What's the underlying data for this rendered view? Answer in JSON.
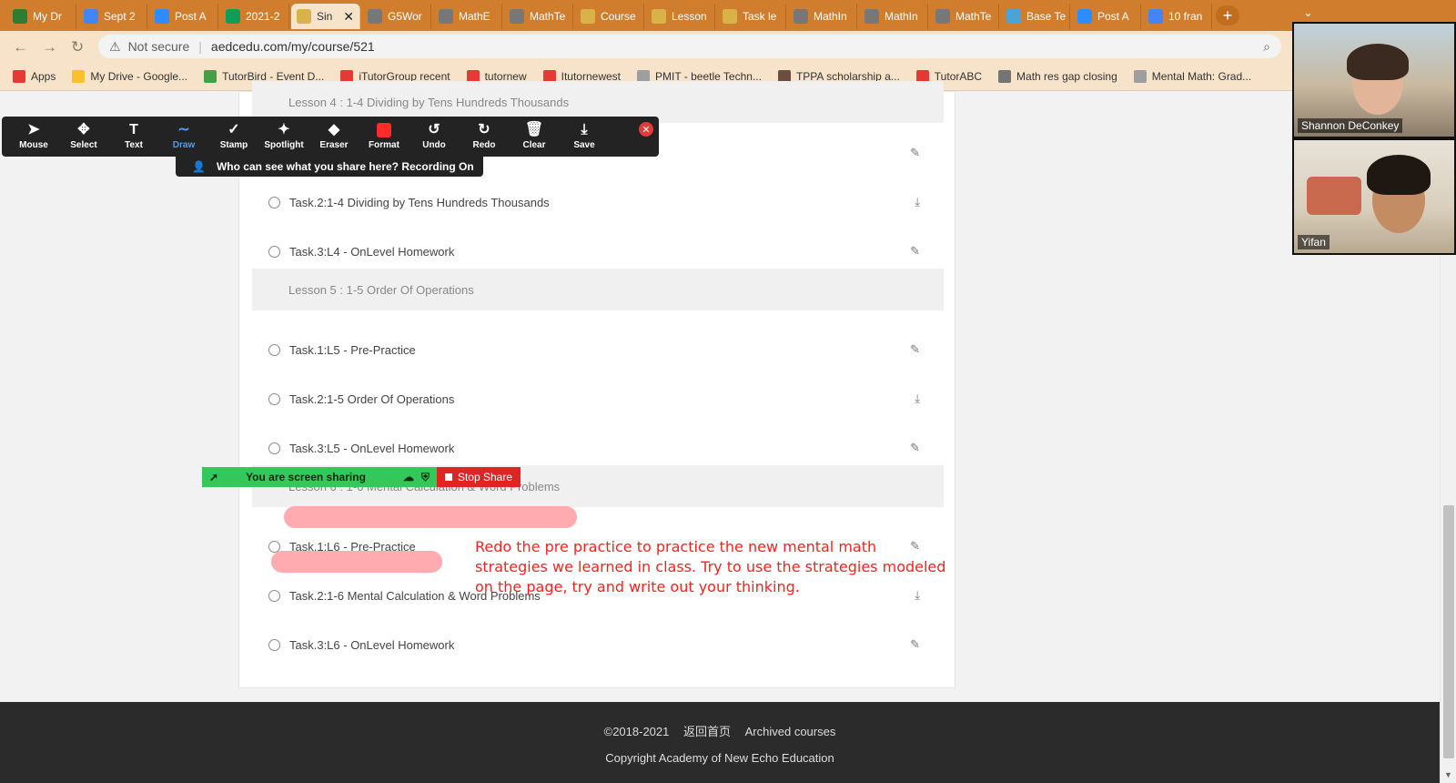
{
  "browser": {
    "tabs": [
      {
        "label": "My Dr",
        "icon": "google-drive-icon",
        "color": "#2f7d32"
      },
      {
        "label": "Sept 2",
        "icon": "google-docs-icon",
        "color": "#4285f4"
      },
      {
        "label": "Post A",
        "icon": "zoom-icon",
        "color": "#2d8cff"
      },
      {
        "label": "2021-2",
        "icon": "google-sheets-icon",
        "color": "#0f9d58"
      },
      {
        "label": "Sin",
        "icon": "site-icon",
        "color": "#d9b34a",
        "active": true
      },
      {
        "label": "G5Wor",
        "icon": "globe-icon",
        "color": "#777777"
      },
      {
        "label": "MathE",
        "icon": "globe-icon",
        "color": "#777777"
      },
      {
        "label": "MathTe",
        "icon": "globe-icon",
        "color": "#777777"
      },
      {
        "label": "Course",
        "icon": "site-icon",
        "color": "#d9b34a"
      },
      {
        "label": "Lesson",
        "icon": "site-icon",
        "color": "#d9b34a"
      },
      {
        "label": "Task le",
        "icon": "site-icon",
        "color": "#d9b34a"
      },
      {
        "label": "MathIn",
        "icon": "globe-icon",
        "color": "#777777"
      },
      {
        "label": "MathIn",
        "icon": "globe-icon",
        "color": "#777777"
      },
      {
        "label": "MathTe",
        "icon": "globe-icon",
        "color": "#777777"
      },
      {
        "label": "Base Te",
        "icon": "site-icon",
        "color": "#4aa3d9"
      },
      {
        "label": "Post A",
        "icon": "zoom-icon",
        "color": "#2d8cff"
      },
      {
        "label": "10 fran",
        "icon": "google-docs-icon",
        "color": "#4285f4"
      }
    ],
    "address": {
      "security": "Not secure",
      "url": "aedcedu.com/my/course/521"
    },
    "bookmarks": [
      {
        "label": "Apps",
        "color": "#e53935"
      },
      {
        "label": "My Drive - Google...",
        "color": "#fbc02d"
      },
      {
        "label": "TutorBird - Event D...",
        "color": "#43a047"
      },
      {
        "label": "iTutorGroup recent",
        "color": "#e53935"
      },
      {
        "label": "tutornew",
        "color": "#e53935"
      },
      {
        "label": "Itutornewest",
        "color": "#e53935"
      },
      {
        "label": "PMIT - beetle Techn...",
        "color": "#9e9e9e"
      },
      {
        "label": "TPPA scholarship a...",
        "color": "#6d4c41"
      },
      {
        "label": "TutorABC",
        "color": "#e53935"
      },
      {
        "label": "Math res gap closing",
        "color": "#757575"
      },
      {
        "label": "Mental Math: Grad...",
        "color": "#9e9e9e"
      }
    ]
  },
  "course": {
    "rows": [
      {
        "kind": "lesson",
        "label": "Lesson 4 : 1-4 Dividing by Tens Hundreds Thousands"
      },
      {
        "kind": "task",
        "label": "",
        "action": "edit-icon"
      },
      {
        "kind": "task",
        "label": "Task.2:1-4 Dividing by Tens Hundreds Thousands",
        "action": "download-icon"
      },
      {
        "kind": "task",
        "label": "Task.3:L4 - OnLevel Homework",
        "action": "edit-icon"
      },
      {
        "kind": "lesson",
        "label": "Lesson 5 : 1-5 Order Of Operations"
      },
      {
        "kind": "task",
        "label": "Task.1:L5 - Pre-Practice",
        "action": "edit-icon"
      },
      {
        "kind": "task",
        "label": "Task.2:1-5 Order Of Operations",
        "action": "download-icon"
      },
      {
        "kind": "task",
        "label": "Task.3:L5 - OnLevel Homework",
        "action": "edit-icon"
      },
      {
        "kind": "lesson",
        "label": "Lesson 6 : 1-6 Mental Calculation & Word Problems"
      },
      {
        "kind": "task",
        "label": "Task.1:L6 - Pre-Practice",
        "action": "edit-icon"
      },
      {
        "kind": "task",
        "label": "Task.2:1-6 Mental Calculation & Word Problems",
        "action": "download-icon"
      },
      {
        "kind": "task",
        "label": "Task.3:L6 - OnLevel Homework",
        "action": "edit-icon"
      }
    ]
  },
  "footer": {
    "copyright_years": "©2018-2021",
    "home_link": "返回首页",
    "archived_link": "Archived courses",
    "company": "Copyright Academy of New Echo Education"
  },
  "zoom_toolbar": {
    "tools": [
      {
        "label": "Mouse",
        "icon": "mouse-pointer-icon"
      },
      {
        "label": "Select",
        "icon": "move-icon"
      },
      {
        "label": "Text",
        "icon": "text-icon"
      },
      {
        "label": "Draw",
        "icon": "draw-icon",
        "active": true
      },
      {
        "label": "Stamp",
        "icon": "checkmark-icon"
      },
      {
        "label": "Spotlight",
        "icon": "spotlight-icon"
      },
      {
        "label": "Eraser",
        "icon": "eraser-icon"
      },
      {
        "label": "Format",
        "icon": "format-icon"
      },
      {
        "label": "Undo",
        "icon": "undo-icon"
      },
      {
        "label": "Redo",
        "icon": "redo-icon"
      },
      {
        "label": "Clear",
        "icon": "trash-icon"
      },
      {
        "label": "Save",
        "icon": "save-icon"
      }
    ],
    "recording_notice": "Who can see what you share here? Recording On",
    "accent_color": "#4e9bff"
  },
  "share_bar": {
    "status": "You are screen sharing",
    "stop_label": "Stop Share",
    "status_color": "#34c759",
    "stop_color": "#e02424"
  },
  "annotation": {
    "text": "Redo the pre practice to practice the new mental math strategies we learned in class.  Try to use the strategies modeled on the page, try and write out your thinking.",
    "color": "#ff1f1f"
  },
  "participants": [
    {
      "name": "Shannon DeConkey"
    },
    {
      "name": "Yifan"
    }
  ]
}
